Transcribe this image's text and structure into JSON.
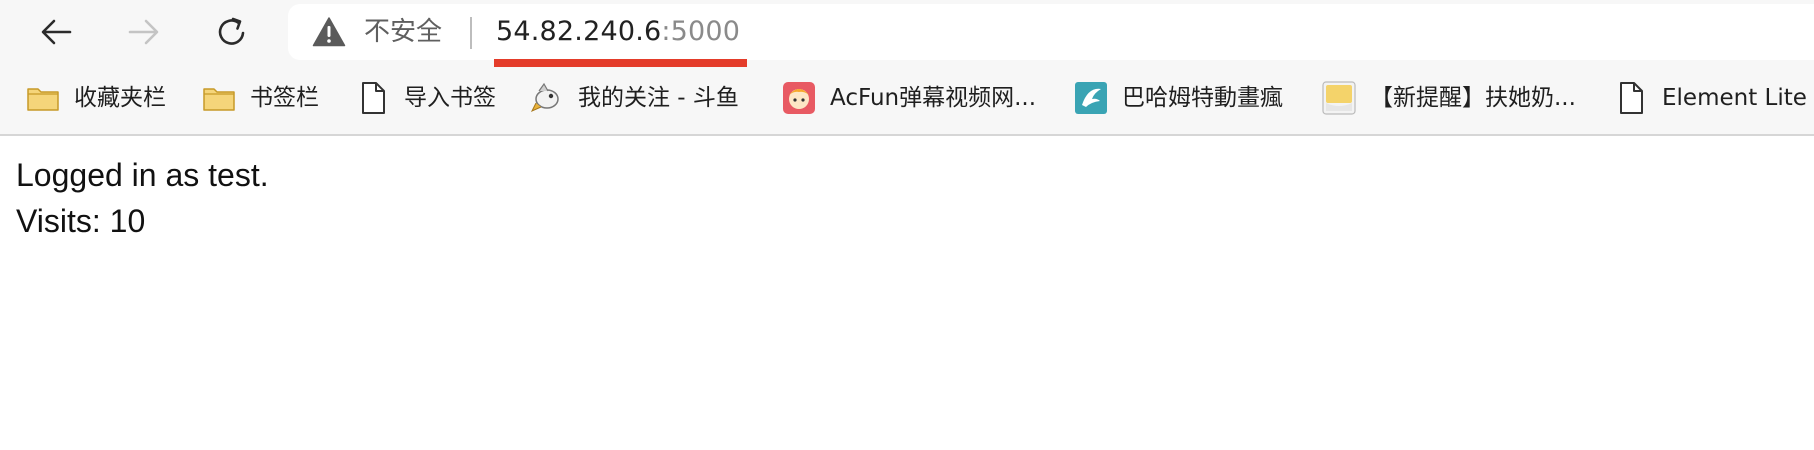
{
  "toolbar": {
    "back_icon": "back-arrow-icon",
    "forward_icon": "forward-arrow-icon",
    "reload_icon": "reload-icon"
  },
  "urlbar": {
    "security_icon": "warning-triangle-icon",
    "security_label": "不安全",
    "host": "54.82.240.6",
    "port": ":5000",
    "accent_color": "#e43c2a"
  },
  "bookmarks": [
    {
      "label": "收藏夹栏",
      "icon": "folder-icon"
    },
    {
      "label": "书签栏",
      "icon": "folder-icon"
    },
    {
      "label": "导入书签",
      "icon": "page-icon"
    },
    {
      "label": "我的关注 - 斗鱼",
      "icon": "douyu-icon"
    },
    {
      "label": "AcFun弹幕视频网...",
      "icon": "acfun-icon"
    },
    {
      "label": "巴哈姆特動畫瘋",
      "icon": "bahamut-icon"
    },
    {
      "label": "【新提醒】扶她奶...",
      "icon": "forum-icon"
    },
    {
      "label": "Element Lite",
      "icon": "page-icon"
    }
  ],
  "page": {
    "line1": "Logged in as test.",
    "line2": "Visits: 10"
  }
}
